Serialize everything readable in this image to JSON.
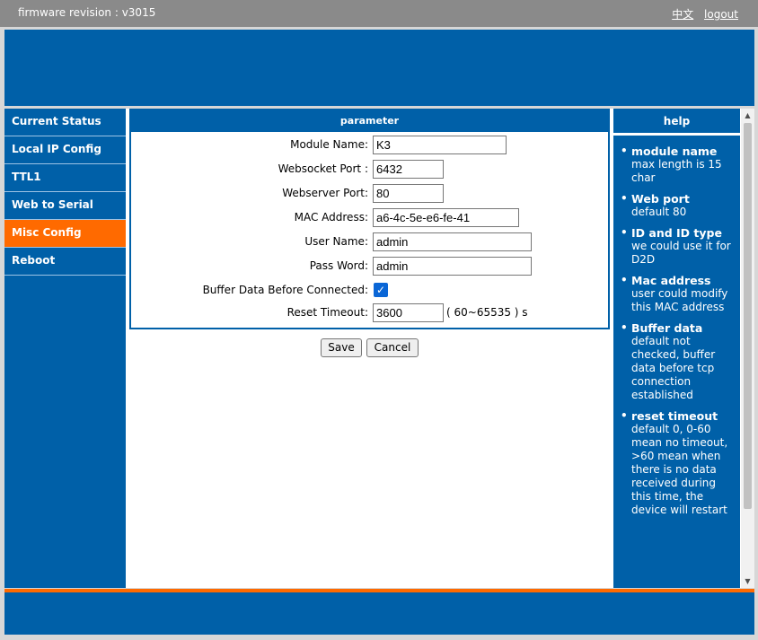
{
  "topbar": {
    "revision": "firmware revision : v3015",
    "lang_link": "中文",
    "logout_link": "logout"
  },
  "sidebar": {
    "items": [
      {
        "label": "Current Status"
      },
      {
        "label": "Local IP Config"
      },
      {
        "label": "TTL1"
      },
      {
        "label": "Web to Serial"
      },
      {
        "label": "Misc Config",
        "active": true
      },
      {
        "label": "Reboot"
      }
    ]
  },
  "param": {
    "title": "parameter",
    "module_name": {
      "label": "Module Name:",
      "value": "K3"
    },
    "websocket_port": {
      "label": "Websocket Port :",
      "value": "6432"
    },
    "webserver_port": {
      "label": "Webserver Port:",
      "value": "80"
    },
    "mac_address": {
      "label": "MAC Address:",
      "value": "a6-4c-5e-e6-fe-41"
    },
    "user_name": {
      "label": "User Name:",
      "value": "admin"
    },
    "pass_word": {
      "label": "Pass Word:",
      "value": "admin"
    },
    "buffer_data": {
      "label": "Buffer Data Before Connected:",
      "checked": true
    },
    "reset_timeout": {
      "label": "Reset Timeout:",
      "value": "3600",
      "unit": "( 60~65535 ) s"
    }
  },
  "buttons": {
    "save": "Save",
    "cancel": "Cancel"
  },
  "help": {
    "title": "help",
    "items": [
      {
        "title": "module name",
        "text": "max length is 15 char"
      },
      {
        "title": "Web port",
        "text": "default 80"
      },
      {
        "title": "ID and ID type",
        "text": "we could use it for D2D"
      },
      {
        "title": "Mac address",
        "text": "user could modify this MAC address"
      },
      {
        "title": "Buffer data",
        "text": "default not checked, buffer data before tcp connection established"
      },
      {
        "title": "reset timeout",
        "text": "default 0, 0-60 mean no timeout, >60 mean when there is no data received during this time, the device will restart"
      }
    ]
  },
  "colors": {
    "brand_blue": "#0060a8",
    "accent_orange": "#ff6a00",
    "topbar_gray": "#8a8a8a"
  }
}
